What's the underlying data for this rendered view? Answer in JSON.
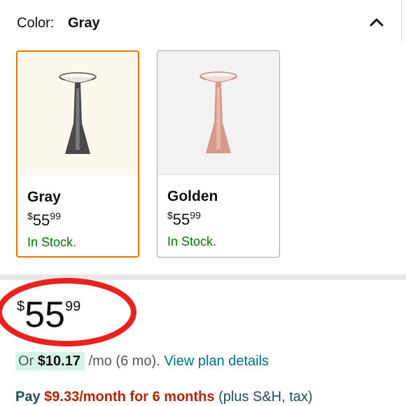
{
  "color_selector": {
    "label": "Color:",
    "selected": "Gray",
    "collapse_icon": "chevron-up-icon"
  },
  "swatches": [
    {
      "name": "Gray",
      "price_symbol": "$",
      "price_whole": "55",
      "price_cents": "99",
      "stock": "In Stock.",
      "selected": true,
      "lamp_color": "#4a4a4a"
    },
    {
      "name": "Golden",
      "price_symbol": "$",
      "price_whole": "55",
      "price_cents": "99",
      "stock": "In Stock.",
      "selected": false,
      "lamp_color": "#d99a8c"
    }
  ],
  "price": {
    "symbol": "$",
    "whole": "55",
    "cents": "99"
  },
  "installment": {
    "prefix": "Or",
    "amount": "$10.17",
    "term": "/mo (6 mo).",
    "link": "View plan details"
  },
  "pay_plan": {
    "pay": "Pay",
    "amount": "$9.33/month for 6 months",
    "note": "(plus S&H, tax)"
  },
  "colors": {
    "selected_border": "#e77600",
    "in_stock": "#007600",
    "link": "#007185",
    "price_red": "#b12704",
    "annotation_circle": "#e8231f"
  }
}
